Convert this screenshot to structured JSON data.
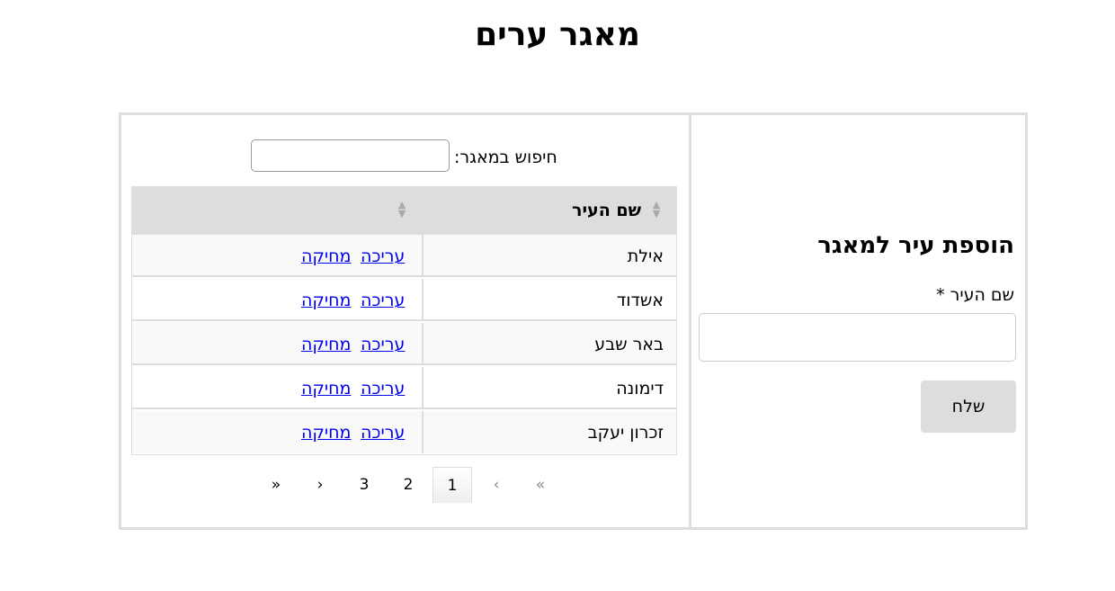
{
  "page": {
    "title": "מאגר ערים"
  },
  "form": {
    "title": "הוספת עיר למאגר",
    "city_label": "שם העיר *",
    "city_value": "",
    "submit_label": "שלח"
  },
  "search": {
    "label": "חיפוש במאגר:",
    "value": ""
  },
  "table": {
    "columns": [
      "שם העיר",
      ""
    ],
    "edit_label": "עריכה",
    "delete_label": "מחיקה",
    "rows": [
      {
        "city": "אילת"
      },
      {
        "city": "אשדוד"
      },
      {
        "city": "באר שבע"
      },
      {
        "city": "דימונה"
      },
      {
        "city": "זכרון יעקב"
      }
    ]
  },
  "pagination": {
    "first": "«",
    "prev": "‹",
    "pages": [
      "1",
      "2",
      "3"
    ],
    "current": "1",
    "next": "›",
    "last": "»"
  },
  "colors": {
    "border": "#dddddd",
    "header_bg": "#dddddd",
    "link": "#0000ee",
    "button_bg": "#dddddd"
  },
  "icons": {
    "sort": "sort-icon"
  }
}
